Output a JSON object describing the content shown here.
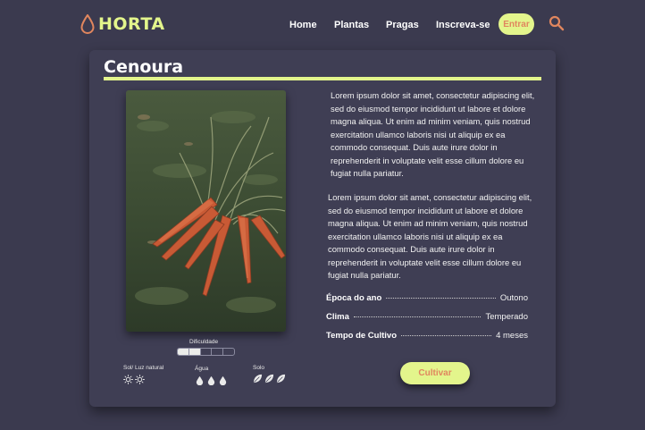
{
  "header": {
    "logo_text": "HORTA",
    "nav": [
      "Home",
      "Plantas",
      "Pragas",
      "Inscreva-se"
    ],
    "login_label": "Entrar",
    "search_icon": "search-icon"
  },
  "plant": {
    "name": "Cenoura",
    "paragraphs": [
      "Lorem ipsum dolor sit amet, consectetur adipiscing elit, sed do eiusmod tempor incididunt ut labore et dolore magna aliqua. Ut enim ad minim veniam, quis nostrud exercitation ullamco laboris nisi ut aliquip ex ea commodo consequat. Duis aute irure dolor in reprehenderit in voluptate velit esse cillum dolore eu fugiat nulla pariatur.",
      "Lorem ipsum dolor sit amet, consectetur adipiscing elit, sed do eiusmod tempor incididunt ut labore et dolore magna aliqua. Ut enim ad minim veniam, quis nostrud exercitation ullamco laboris nisi ut aliquip ex ea commodo consequat. Duis aute irure dolor in reprehenderit in voluptate velit esse cillum dolore eu fugiat nulla pariatur."
    ],
    "info": [
      {
        "label": "Época do ano",
        "value": "Outono"
      },
      {
        "label": "Clima",
        "value": "Temperado"
      },
      {
        "label": "Tempo de Cultivo",
        "value": "4 meses"
      }
    ],
    "difficulty": {
      "label": "Dificuldade",
      "level": 2,
      "max": 5
    },
    "attributes": {
      "sun": {
        "label": "Sol/  Luz natural",
        "count": 2,
        "icon": "sun-icon"
      },
      "water": {
        "label": "Água",
        "count": 3,
        "icon": "water-drop-icon"
      },
      "soil": {
        "label": "Solo",
        "count": 3,
        "icon": "leaf-icon"
      }
    },
    "cultivate_label": "Cultivar"
  },
  "colors": {
    "background": "#3b3a4f",
    "card": "#3f3e54",
    "accent": "#e3f58c",
    "accent_text": "#e0865e"
  }
}
